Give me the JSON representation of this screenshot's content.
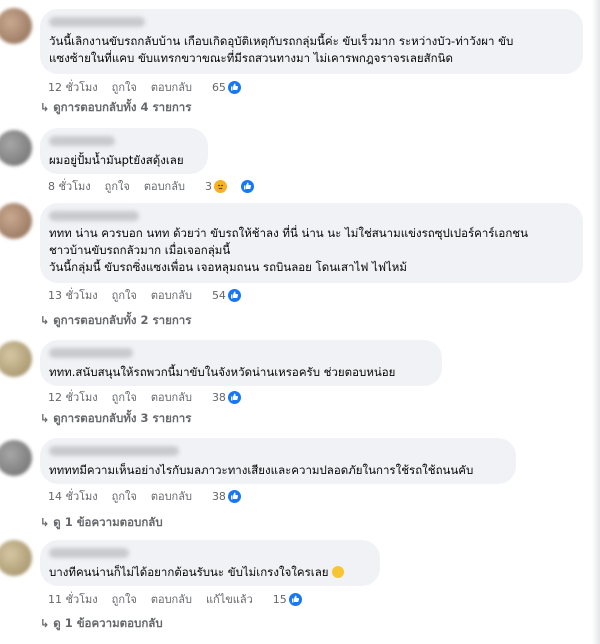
{
  "comments": [
    {
      "text": "วันนี้เลิกงานขับรถกลับบ้าน เกือบเกิดอุบัติเหตุกับรถกลุ่มนี้ค่ะ ขับเร็วมาก ระหว่างบัว-ท่าวังผา ขับ\nแซงซ้ายในที่แคบ ขับแทรกขวาขณะที่มีรถสวนทางมา ไม่เคารพกฎจราจรเลยสักนิด",
      "time": "12 ชั่วโมง",
      "like": "ถูกใจ",
      "reply": "ตอบกลับ",
      "reactions": "65",
      "reaction_icons": [
        "like-icon"
      ],
      "replies_label": "ดูการตอบกลับทั้ง 4 รายการ"
    },
    {
      "text": "ผมอยู่ปั้มน้ำมันptยังสดุ้งเลย",
      "time": "8 ชั่วโมง",
      "like": "ถูกใจ",
      "reply": "ตอบกลับ",
      "reactions": "3",
      "reaction_icons": [
        "sad-icon",
        "like-icon"
      ],
      "replies_label": ""
    },
    {
      "text": "ททท น่าน ควรบอก นทท ด้วยว่า ขับรถให้ช้าลง ที่นี่ น่าน นะ ไม่ใช่สนามแข่งรถซุปเปอร์คาร์เอกชน\nชาวบ้านขับรถกลัวมาก เมื่อเจอกลุ่มนี้\nวันนี้กลุ่มนี้ ขับรถซิ่งแซงเพื่อน เจอหลุมถนน รถบินลอย โดนเสาไฟ ไฟไหม้",
      "time": "13 ชั่วโมง",
      "like": "ถูกใจ",
      "reply": "ตอบกลับ",
      "reactions": "54",
      "reaction_icons": [
        "like-icon"
      ],
      "replies_label": "ดูการตอบกลับทั้ง 2 รายการ"
    },
    {
      "text": "ททท.สนับสนุนให้รถพวกนี้มาขับในจังหวัดน่านเหรอครับ ช่วยตอบหน่อย",
      "time": "12 ชั่วโมง",
      "like": "ถูกใจ",
      "reply": "ตอบกลับ",
      "reactions": "38",
      "reaction_icons": [
        "like-icon"
      ],
      "replies_label": "ดูการตอบกลับทั้ง 3 รายการ"
    },
    {
      "text": "ททททมีความเห็นอย่างไรกับมลภาวะทางเสียงและความปลอดภัยในการใช้รถใช้ถนนคับ",
      "time": "14 ชั่วโมง",
      "like": "ถูกใจ",
      "reply": "ตอบกลับ",
      "reactions": "38",
      "reaction_icons": [
        "like-icon"
      ],
      "replies_label": "ดู 1 ข้อความตอบกลับ"
    },
    {
      "text": "บางทีคนน่านก็ไม่ได้อยากต้อนรับนะ ขับไม่เกรงใจใครเลย",
      "time": "11 ชั่วโมง",
      "like": "ถูกใจ",
      "reply": "ตอบกลับ",
      "edited": "แก้ไขแล้ว",
      "reactions": "15",
      "reaction_icons": [
        "like-icon"
      ],
      "replies_label": "ดู 1 ข้อความตอบกลับ"
    }
  ]
}
